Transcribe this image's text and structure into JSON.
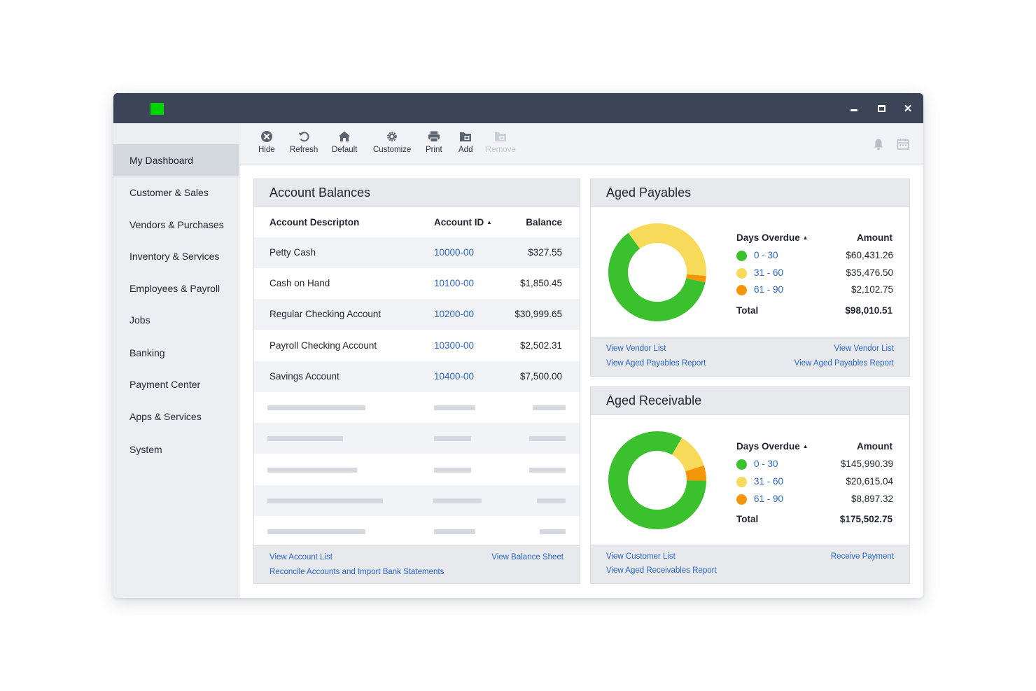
{
  "window": {
    "controls": {
      "minimize_icon": "minimize-icon",
      "maximize_icon": "maximize-icon",
      "close_glyph": "✕"
    }
  },
  "sidebar": {
    "items": [
      {
        "label": "My Dashboard",
        "active": true
      },
      {
        "label": "Customer & Sales"
      },
      {
        "label": "Vendors & Purchases"
      },
      {
        "label": "Inventory & Services"
      },
      {
        "label": "Employees & Payroll"
      },
      {
        "label": "Jobs"
      },
      {
        "label": "Banking"
      },
      {
        "label": "Payment Center"
      },
      {
        "label": "Apps & Services"
      },
      {
        "label": "System"
      }
    ]
  },
  "toolbar": {
    "items": [
      {
        "label": "Hide",
        "icon": "close-circle-icon"
      },
      {
        "label": "Refresh",
        "icon": "refresh-icon"
      },
      {
        "label": "Default",
        "icon": "home-icon"
      },
      {
        "label": "Customize",
        "icon": "gear-icon"
      },
      {
        "label": "Print",
        "icon": "printer-icon"
      },
      {
        "label": "Add",
        "icon": "add-folder-icon"
      },
      {
        "label": "Remove",
        "icon": "remove-folder-icon",
        "disabled": true
      }
    ],
    "right_icons": [
      "bell-icon",
      "calendar-icon"
    ]
  },
  "account_balances": {
    "title": "Account Balances",
    "columns": {
      "description": "Account Descripton",
      "account_id": "Account ID",
      "balance": "Balance"
    },
    "sort_glyph": "▲",
    "rows": [
      {
        "description": "Petty Cash",
        "account_id": "10000-00",
        "balance": "$327.55"
      },
      {
        "description": "Cash on Hand",
        "account_id": "10100-00",
        "balance": "$1,850.45"
      },
      {
        "description": "Regular Checking Account",
        "account_id": "10200-00",
        "balance": "$30,999.65"
      },
      {
        "description": "Payroll Checking Account",
        "account_id": "10300-00",
        "balance": "$2,502.31"
      },
      {
        "description": "Savings Account",
        "account_id": "10400-00",
        "balance": "$7,500.00"
      }
    ],
    "links": {
      "account_list": "View Account List",
      "balance_sheet": "View Balance Sheet",
      "reconcile": "Reconcile Accounts and Import Bank Statements"
    }
  },
  "aged_payables": {
    "title": "Aged Payables",
    "legend_header": "Days Overdue",
    "amount_header": "Amount",
    "sort_glyph": "▲",
    "buckets": [
      {
        "range": "0 - 30",
        "amount": "$60,431.26",
        "value": 60431.26,
        "color": "#3cc12e"
      },
      {
        "range": "31 - 60",
        "amount": "$35,476.50",
        "value": 35476.5,
        "color": "#f8da5b"
      },
      {
        "range": "61 - 90",
        "amount": "$2,102.75",
        "value": 2102.75,
        "color": "#f5950a"
      }
    ],
    "total_label": "Total",
    "total": "$98,010.51",
    "links": {
      "left_1": "View Vendor List",
      "left_2": "View Aged Payables Report",
      "right_1": "View Vendor List",
      "right_2": "View Aged Payables Report"
    }
  },
  "aged_receivable": {
    "title": "Aged Receivable",
    "legend_header": "Days Overdue",
    "amount_header": "Amount",
    "sort_glyph": "▲",
    "buckets": [
      {
        "range": "0 - 30",
        "amount": "$145,990.39",
        "value": 145990.39,
        "color": "#3cc12e"
      },
      {
        "range": "31 - 60",
        "amount": "$20,615.04",
        "value": 20615.04,
        "color": "#f8da5b"
      },
      {
        "range": "61 - 90",
        "amount": "$8,897.32",
        "value": 8897.32,
        "color": "#f5950a"
      }
    ],
    "total_label": "Total",
    "total": "$175,502.75",
    "links": {
      "customer_list": "View Customer List",
      "receive_payment": "Receive Payment",
      "aged_report": "View Aged Receivables Report"
    }
  },
  "colors": {
    "titlebar": "#3b4557",
    "brand": "#00d400",
    "link": "#2a66c9"
  }
}
